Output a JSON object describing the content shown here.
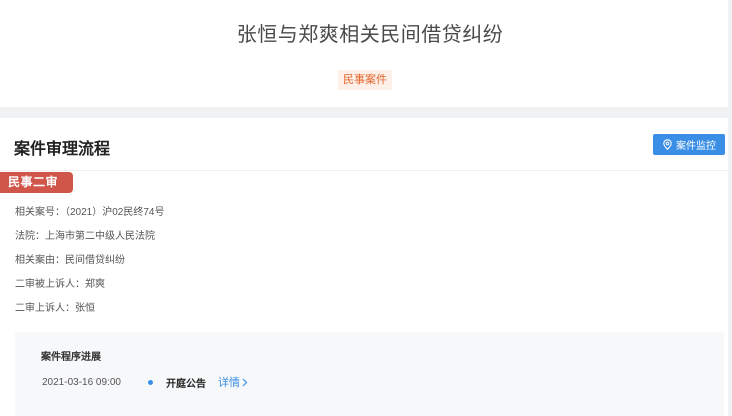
{
  "header": {
    "title": "张恒与郑爽相关民间借贷纠纷",
    "case_type_badge": "民事案件"
  },
  "section": {
    "title": "案件审理流程",
    "monitor_button": "案件监控",
    "stage_tag": "民事二审"
  },
  "case_info": [
    {
      "label": "相关案号：",
      "value": "（2021）沪02民终74号"
    },
    {
      "label": "法院：",
      "value": "上海市第二中级人民法院"
    },
    {
      "label": "相关案由：",
      "value": "民间借贷纠纷"
    },
    {
      "label": "二审被上诉人：",
      "value": "郑爽"
    },
    {
      "label": "二审上诉人：",
      "value": "张恒"
    }
  ],
  "progress": {
    "title": "案件程序进展",
    "items": [
      {
        "date": "2021-03-16 09:00",
        "event": "开庭公告",
        "link": "详情"
      }
    ]
  },
  "colors": {
    "accent_blue": "#3a8ee6",
    "stage_red": "#d0564a",
    "badge_orange": "#e5642c",
    "page_bg": "#f0f1f3"
  },
  "icons": {
    "monitor": "location-pin-icon",
    "detail": "chevron-right-icon"
  }
}
